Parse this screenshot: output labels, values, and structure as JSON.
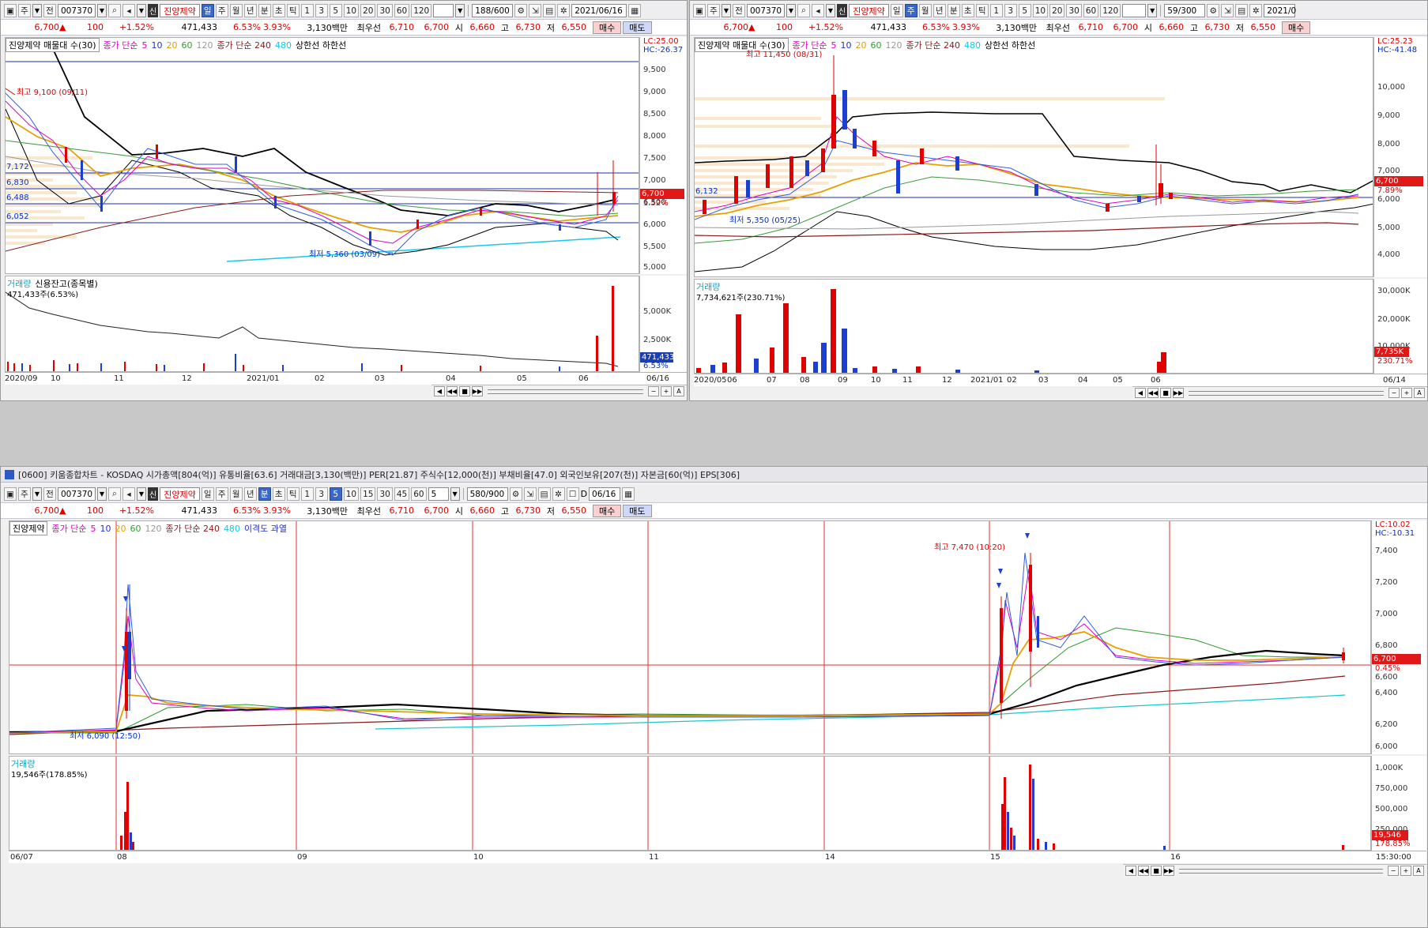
{
  "stock": {
    "code": "007370",
    "name": "진양제약",
    "badge": "신",
    "price": "6,700",
    "change": "100",
    "change_pct": "+1.52%",
    "volume": "471,433",
    "turnover_pct": "6.53%",
    "vol_ratio": "3.93%",
    "amount": "3,130백만",
    "best_bid_label": "최우선",
    "best_ask": "6,710",
    "best_bid": "6,700",
    "open_label": "시",
    "open": "6,660",
    "high_label": "고",
    "high": "6,730",
    "low_label": "저",
    "low": "6,550",
    "buy": "매수",
    "sell": "매도"
  },
  "toolbar": {
    "jusik": "주",
    "jeon": "전",
    "periods": [
      "일",
      "주",
      "월",
      "년",
      "분",
      "초",
      "틱"
    ],
    "intervals": [
      "1",
      "3",
      "5",
      "10",
      "20",
      "30",
      "60",
      "120"
    ],
    "minute_intervals": [
      "1",
      "3",
      "5",
      "10",
      "15",
      "30",
      "45",
      "60"
    ],
    "minute_sel": "5",
    "d_label": "D",
    "d_date": "06/16"
  },
  "top_left": {
    "count": "188",
    "count_total": "/600",
    "date": "2021/06/16",
    "legend": {
      "box": "진양제약 매물대 수(30)",
      "ma_label": "종가 단순",
      "ma5": "5",
      "ma10": "10",
      "ma20": "20",
      "ma60": "60",
      "ma120": "120",
      "ma240_label": "종가 단순 240",
      "ma480": "480",
      "limit": "상한선 하한선"
    },
    "lc": "LC:25.00",
    "hc": "HC:-26.37",
    "y_ticks": [
      "9,500",
      "9,000",
      "8,500",
      "8,000",
      "7,500",
      "7,000",
      "6,500",
      "6,000",
      "5,500",
      "5,000"
    ],
    "hlabels": [
      "7,172",
      "6,830",
      "6,488",
      "6,052"
    ],
    "price_box": "6,700",
    "pct_box": "1.52%",
    "high_note": "최고 9,100 (09/11)",
    "low_note": "최저 5,360 (03/09)",
    "vol_title": "거래량",
    "credit_title": "신용잔고(종목별)",
    "vol_value": "471,433주(6.53%)",
    "vol_ticks": [
      "5,000K",
      "2,500K"
    ],
    "vol_box": "471,433",
    "vol_box_pct": "6.53%",
    "x_ticks": [
      "2020/09",
      "10",
      "11",
      "12",
      "2021/01",
      "02",
      "03",
      "04",
      "05",
      "06"
    ],
    "x_last": "06/16"
  },
  "top_right": {
    "count": "59",
    "count_total": "/300",
    "date": "2021/0",
    "lc": "LC:25.23",
    "hc": "HC:-41.48",
    "y_ticks": [
      "10,000",
      "9,000",
      "8,000",
      "7,000",
      "6,000",
      "5,000",
      "4,000"
    ],
    "hlabel": "6,132",
    "price_box": "6,700",
    "pct_box": "7.89%",
    "high_note": "최고 11,450 (08/31)",
    "low_note": "최저 5,350 (05/25)",
    "vol_title": "거래량",
    "vol_value": "7,734,621주(230.71%)",
    "vol_ticks": [
      "30,000K",
      "20,000K",
      "10,000K"
    ],
    "vol_box": "7,735K",
    "vol_box_pct": "230.71%",
    "x_ticks": [
      "2020/05",
      "06",
      "07",
      "08",
      "09",
      "10",
      "11",
      "12",
      "2021/01",
      "02",
      "03",
      "04",
      "05",
      "06"
    ],
    "x_last": "06/14"
  },
  "bottom": {
    "window_title": "[0600] 키움종합차트 - KOSDAQ 시가총액[804(억)] 유통비율[63.6] 거래대금[3,130(백만)] PER[21.87] 주식수[12,000(천)] 부채비율[47.0] 외국인보유[207(천)] 자본금[60(억)] EPS[306]",
    "count": "580",
    "count_total": "/900",
    "legend": {
      "box": "진양제약",
      "ma_label": "종가 단순",
      "ma5": "5",
      "ma10": "10",
      "ma20": "20",
      "ma60": "60",
      "ma120": "120",
      "ma240_label": "종가 단순 240",
      "ma480": "480",
      "disparity": "이격도 과열"
    },
    "lc": "LC:10.02",
    "hc": "HC:-10.31",
    "y_ticks": [
      "7,400",
      "7,200",
      "7,000",
      "6,800",
      "6,600",
      "6,400",
      "6,200",
      "6,000"
    ],
    "price_box": "6,700",
    "pct_box": "0.45%",
    "high_note": "최고 7,470 (10:20)",
    "low_note": "최저 6,090 (12:50)",
    "vol_title": "거래량",
    "vol_value": "19,546주(178.85%)",
    "vol_ticks": [
      "1,000K",
      "750,000",
      "500,000",
      "250,000"
    ],
    "vol_box": "19,546",
    "vol_box_pct": "178.85%",
    "x_ticks": [
      "06/07",
      "08",
      "09",
      "10",
      "11",
      "14",
      "15",
      "16"
    ],
    "x_last": "15:30:00"
  }
}
